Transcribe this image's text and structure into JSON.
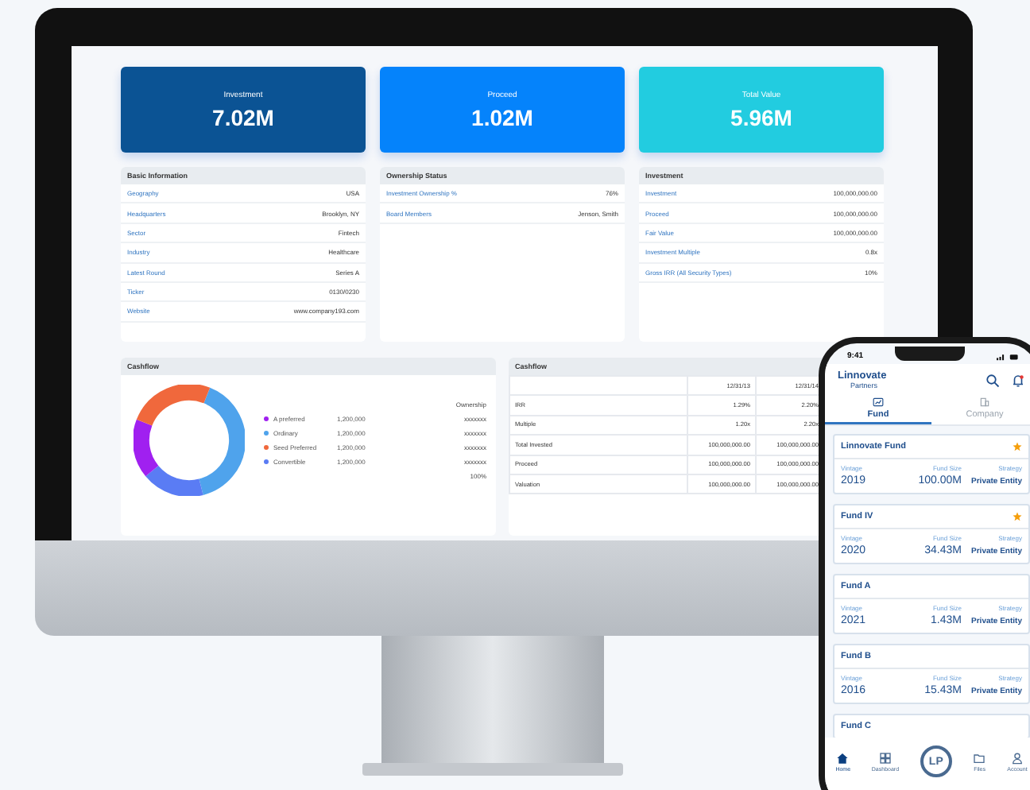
{
  "monitor": {
    "stats": [
      {
        "label": "Investment",
        "value": "7.02M",
        "color": "#0b5394"
      },
      {
        "label": "Proceed",
        "value": "1.02M",
        "color": "#0583fb"
      },
      {
        "label": "Total Value",
        "value": "5.96M",
        "color": "#22cce0"
      }
    ],
    "info_panels": [
      {
        "title": "Basic Information",
        "rows": [
          {
            "label": "Geography",
            "value": "USA"
          },
          {
            "label": "Headquarters",
            "value": "Brooklyn, NY"
          },
          {
            "label": "Sector",
            "value": "Fintech"
          },
          {
            "label": "Industry",
            "value": "Healthcare"
          },
          {
            "label": "Latest Round",
            "value": "Series A"
          },
          {
            "label": "Ticker",
            "value": "0130/0230"
          },
          {
            "label": "Website",
            "value": "www.company193.com"
          }
        ]
      },
      {
        "title": "Ownership Status",
        "rows": [
          {
            "label": "Investment Ownership %",
            "value": "76%"
          },
          {
            "label": "Board Members",
            "value": "Jenson, Smith"
          }
        ]
      },
      {
        "title": "Investment",
        "rows": [
          {
            "label": "Investment",
            "value": "100,000,000.00"
          },
          {
            "label": "Proceed",
            "value": "100,000,000.00"
          },
          {
            "label": "Fair Value",
            "value": "100,000,000.00"
          },
          {
            "label": "Investment Multiple",
            "value": "0.8x"
          },
          {
            "label": "Gross IRR (All Security Types)",
            "value": "10%"
          }
        ]
      }
    ],
    "cashflow_chart": {
      "title": "Cashflow",
      "ownership_header": "Ownership",
      "total": "100%",
      "legend": [
        {
          "name": "A preferred",
          "amount": "1,200,000",
          "ownership": "xxxxxxx",
          "color": "#a020f0"
        },
        {
          "name": "Ordinary",
          "amount": "1,200,000",
          "ownership": "xxxxxxx",
          "color": "#4fa3ec"
        },
        {
          "name": "Seed Preferred",
          "amount": "1,200,000",
          "ownership": "xxxxxxx",
          "color": "#f0683c"
        },
        {
          "name": "Convertible",
          "amount": "1,200,000",
          "ownership": "xxxxxxx",
          "color": "#5a7cf4"
        }
      ]
    },
    "cashflow_table": {
      "title": "Cashflow",
      "columns": [
        "12/31/13",
        "12/31/14"
      ],
      "rows": [
        {
          "label": "IRR",
          "values": [
            "1.29%",
            "2.20%"
          ]
        },
        {
          "label": "Multiple",
          "values": [
            "1.20x",
            "2.20x"
          ]
        },
        {
          "label": "Total Invested",
          "values": [
            "100,000,000.00",
            "100,000,000.00"
          ]
        },
        {
          "label": "Proceed",
          "values": [
            "100,000,000.00",
            "100,000,000.00"
          ]
        },
        {
          "label": "Valuation",
          "values": [
            "100,000,000.00",
            "100,000,000.00"
          ]
        }
      ]
    }
  },
  "phone": {
    "time": "9:41",
    "logo": [
      "Linnovate",
      "Partners"
    ],
    "tabs": [
      {
        "label": "Fund",
        "selected": true
      },
      {
        "label": "Company",
        "selected": false
      }
    ],
    "funds": [
      {
        "name": "Linnovate Fund",
        "starred": true,
        "vintage_label": "Vintage",
        "vintage": "2019",
        "size_label": "Fund Size",
        "size": "100.00M",
        "strategy_label": "Strategy",
        "strategy": "Private Entity"
      },
      {
        "name": "Fund IV",
        "starred": true,
        "vintage_label": "Vintage",
        "vintage": "2020",
        "size_label": "Fund Size",
        "size": "34.43M",
        "strategy_label": "Strategy",
        "strategy": "Private Entity"
      },
      {
        "name": "Fund A",
        "starred": false,
        "vintage_label": "Vintage",
        "vintage": "2021",
        "size_label": "Fund Size",
        "size": "1.43M",
        "strategy_label": "Strategy",
        "strategy": "Private Entity"
      },
      {
        "name": "Fund B",
        "starred": false,
        "vintage_label": "Vintage",
        "vintage": "2016",
        "size_label": "Fund Size",
        "size": "15.43M",
        "strategy_label": "Strategy",
        "strategy": "Private Entity"
      },
      {
        "name": "Fund C",
        "starred": false
      }
    ],
    "nav": [
      {
        "label": "Home",
        "kind": "home",
        "selected": true
      },
      {
        "label": "Dashboard",
        "kind": "dashboard",
        "selected": false
      },
      {
        "label": "LP",
        "kind": "logo",
        "selected": false
      },
      {
        "label": "Files",
        "kind": "files",
        "selected": false
      },
      {
        "label": "Account",
        "kind": "account",
        "selected": false
      }
    ]
  }
}
